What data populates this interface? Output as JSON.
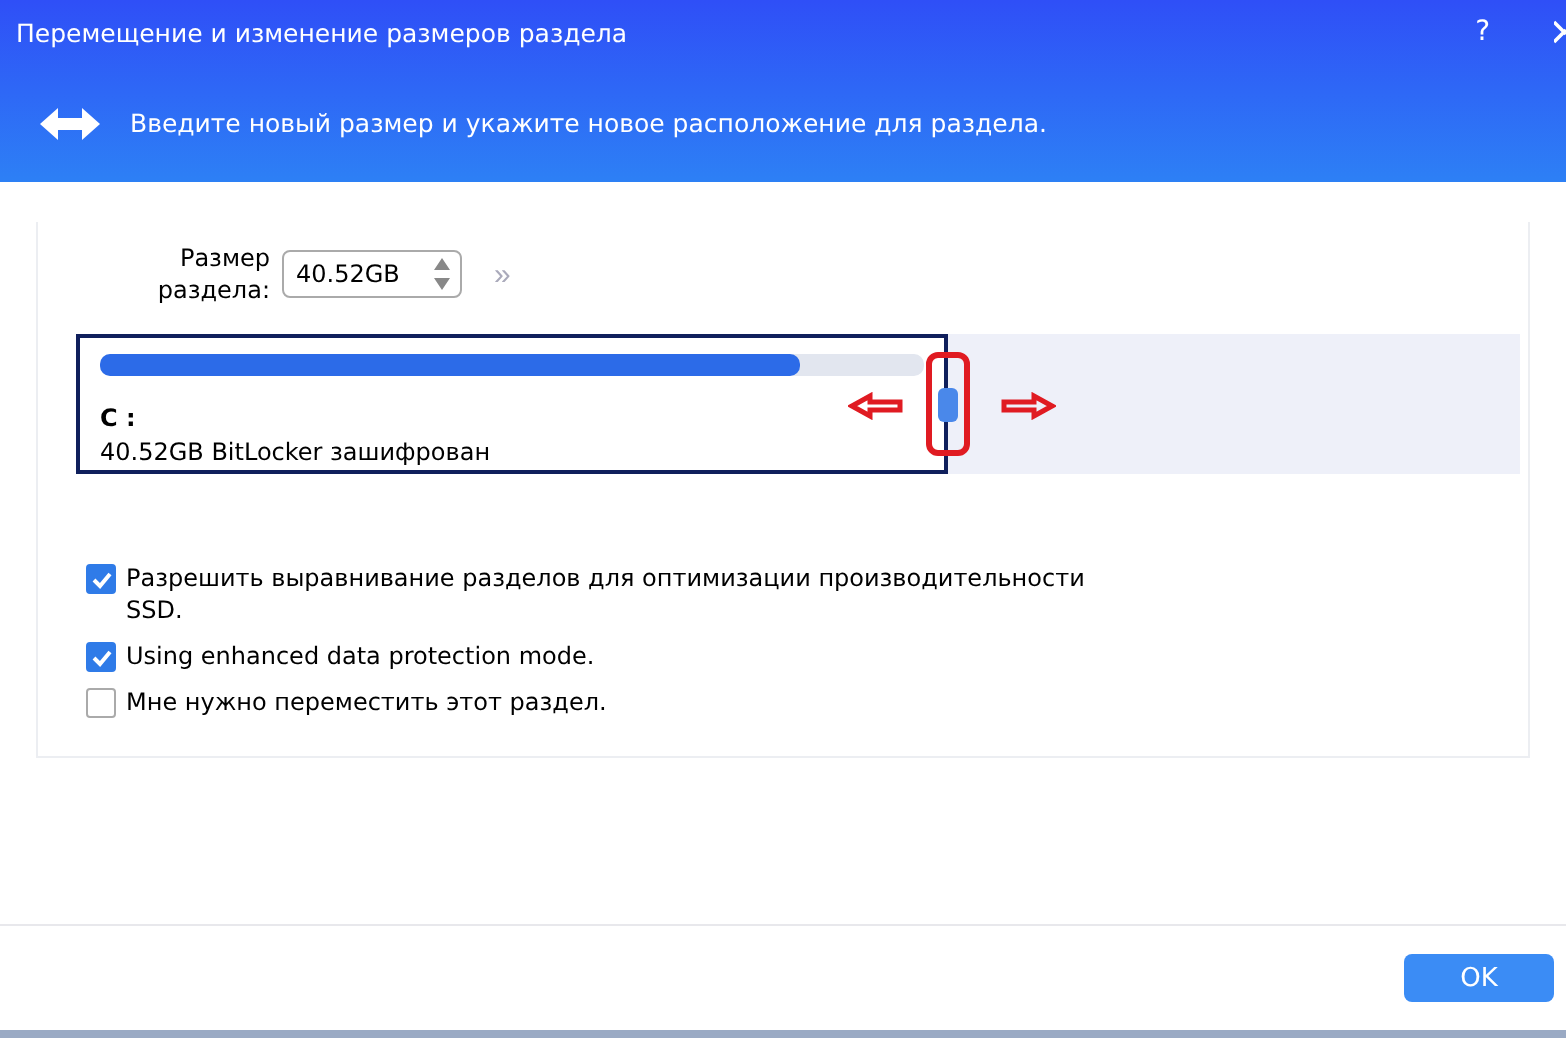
{
  "window": {
    "title": "Перемещение и изменение размеров раздела",
    "help": "?"
  },
  "banner": {
    "text": "Введите новый размер и укажите новое расположение для раздела."
  },
  "size_field": {
    "label": "Размер раздела:",
    "value": "40.52GB",
    "more": "»"
  },
  "disk_map": {
    "partition": {
      "selected": true,
      "name": "C :",
      "info": "40.52GB BitLocker зашифрован",
      "level": 0.85
    }
  },
  "options": [
    {
      "label": "Разрешить выравнивание разделов для оптимизации производительности SSD.",
      "checked": true
    },
    {
      "label": "Using enhanced data protection mode.",
      "checked": true
    },
    {
      "label": "Мне нужно переместить этот раздел.",
      "checked": false
    }
  ],
  "buttons": [
    {
      "label": "OK"
    }
  ]
}
